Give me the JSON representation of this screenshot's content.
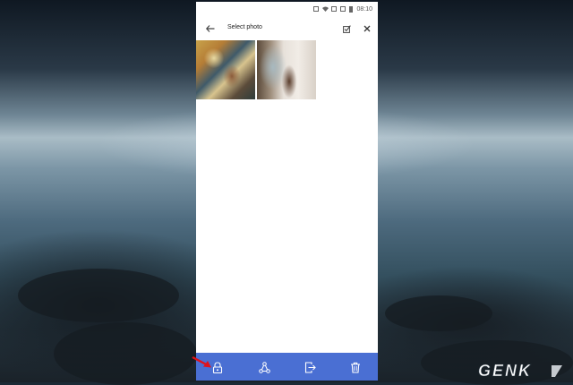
{
  "status_bar": {
    "time": "08:10"
  },
  "header": {
    "title": "Select photo"
  },
  "icons": {
    "back": "arrow-left-icon",
    "select_all": "checkbox-icon",
    "close": "close-icon",
    "lock": "lock-icon",
    "share": "share-icon",
    "move": "move-out-icon",
    "delete": "trash-icon"
  },
  "photos": [
    {
      "name": "painting-photo"
    },
    {
      "name": "girl-peace-sign-photo"
    }
  ],
  "colors": {
    "bottom_bar": "#4a6fd3",
    "annotation_arrow": "#e0121b"
  },
  "watermark": {
    "text": "GENK"
  }
}
